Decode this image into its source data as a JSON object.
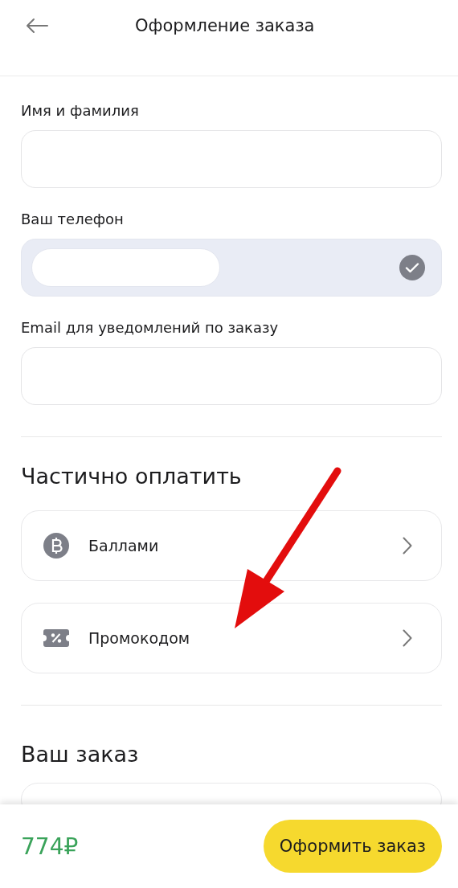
{
  "header": {
    "title": "Оформление заказа"
  },
  "fields": [
    {
      "label": "Имя и фамилия",
      "verified": false,
      "redacted": false
    },
    {
      "label": "Ваш телефон",
      "verified": true,
      "redacted": true
    },
    {
      "label": "Email для уведомлений по заказу",
      "verified": false,
      "redacted": false
    }
  ],
  "partial_payment": {
    "heading": "Частично оплатить",
    "options": [
      {
        "kind": "points",
        "label": "Баллами"
      },
      {
        "kind": "promo",
        "label": "Промокодом"
      }
    ]
  },
  "order": {
    "heading": "Ваш заказ"
  },
  "footer": {
    "total": "774₽",
    "button": "Оформить заказ"
  }
}
